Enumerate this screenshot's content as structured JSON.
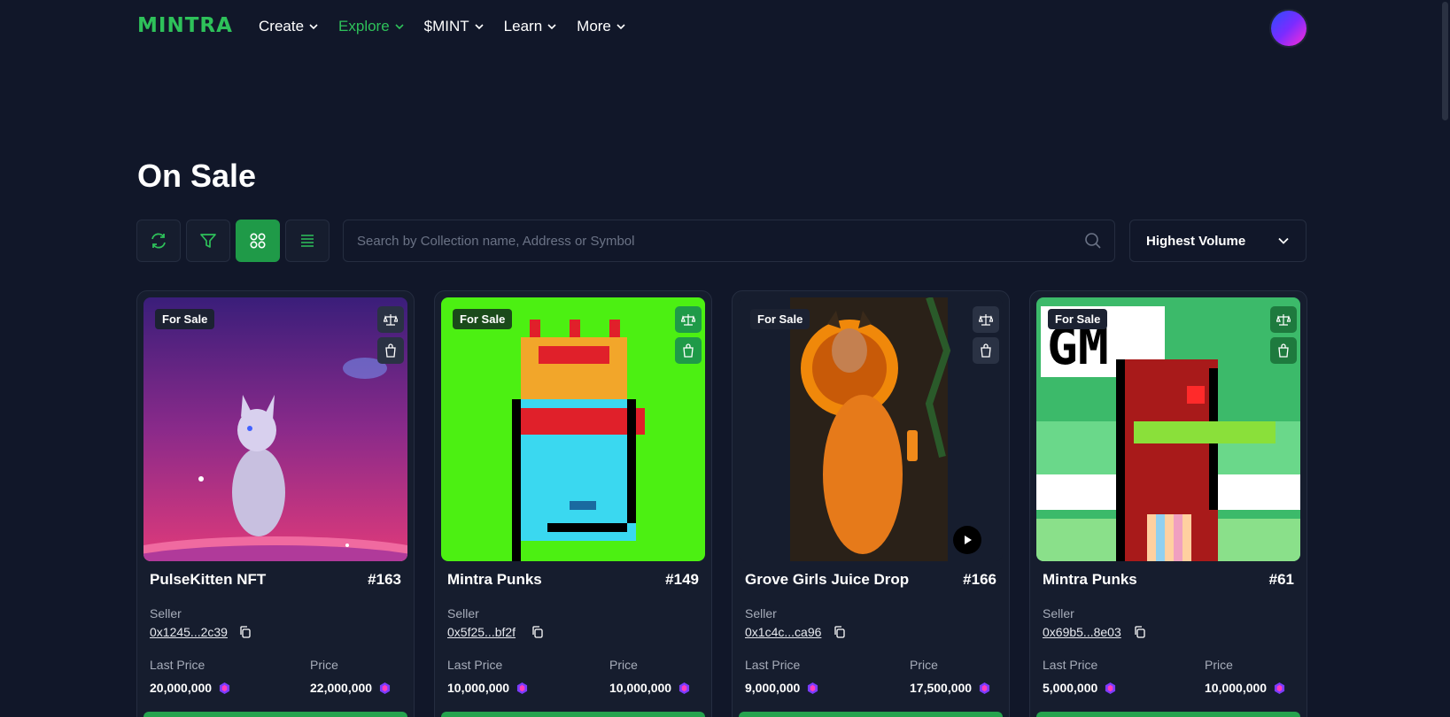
{
  "brand": {
    "logo": "MINTRA",
    "accent": "#2ec15a"
  },
  "nav": [
    {
      "label": "Create",
      "active": false
    },
    {
      "label": "Explore",
      "active": true
    },
    {
      "label": "$MINT",
      "active": false
    },
    {
      "label": "Learn",
      "active": false
    },
    {
      "label": "More",
      "active": false
    }
  ],
  "page": {
    "title": "On Sale"
  },
  "toolbar": {
    "refresh_icon": "refresh-icon",
    "filter_icon": "filter-icon",
    "grid_icon": "grid-view-icon",
    "list_icon": "list-view-icon",
    "active_view": "grid"
  },
  "search": {
    "placeholder": "Search by Collection name, Address or Symbol",
    "value": ""
  },
  "sort": {
    "selected": "Highest Volume"
  },
  "labels": {
    "seller": "Seller",
    "last_price": "Last Price",
    "price": "Price",
    "for_sale": "For Sale"
  },
  "cards": [
    {
      "name": "PulseKitten NFT",
      "id": "#163",
      "seller": "0x1245...2c39",
      "last_price": "20,000,000",
      "price": "22,000,000",
      "image": "kitten-in-space"
    },
    {
      "name": "Mintra Punks",
      "id": "#149",
      "seller": "0x5f25...bf2f",
      "last_price": "10,000,000",
      "price": "10,000,000",
      "image": "pixel-punk-crown"
    },
    {
      "name": "Grove Girls Juice Drop",
      "id": "#166",
      "seller": "0x1c4c...ca96",
      "last_price": "9,000,000",
      "price": "17,500,000",
      "image": "orange-tiger-girl",
      "video": true
    },
    {
      "name": "Mintra Punks",
      "id": "#61",
      "seller": "0x69b5...8e03",
      "last_price": "5,000,000",
      "price": "10,000,000",
      "image": "pixel-gm-punk"
    }
  ]
}
